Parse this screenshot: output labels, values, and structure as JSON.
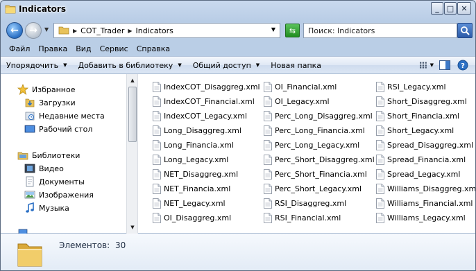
{
  "window": {
    "title": "Indicators"
  },
  "address": {
    "crumbs": [
      "COT_Trader",
      "Indicators"
    ]
  },
  "search": {
    "placeholder": "Поиск: Indicators"
  },
  "menu": [
    "Файл",
    "Правка",
    "Вид",
    "Сервис",
    "Справка"
  ],
  "toolbar": {
    "organize": "Упорядочить",
    "add_to_library": "Добавить в библиотеку",
    "share": "Общий доступ",
    "new_folder": "Новая папка"
  },
  "navpane": {
    "favorites": {
      "label": "Избранное",
      "items": [
        "Загрузки",
        "Недавние места",
        "Рабочий стол"
      ]
    },
    "libraries": {
      "label": "Библиотеки",
      "items": [
        "Видео",
        "Документы",
        "Изображения",
        "Музыка"
      ]
    }
  },
  "files": [
    [
      "IndexCOT_Disaggreg.xml",
      "IndexCOT_Financial.xml",
      "IndexCOT_Legacy.xml",
      "Long_Disaggreg.xml",
      "Long_Financia.xml",
      "Long_Legacy.xml",
      "NET_Disaggreg.xml",
      "NET_Financia.xml",
      "NET_Legacy.xml",
      "OI_Disaggreg.xml"
    ],
    [
      "OI_Financial.xml",
      "OI_Legacy.xml",
      "Perc_Long_Disaggreg.xml",
      "Perc_Long_Financia.xml",
      "Perc_Long_Legacy.xml",
      "Perc_Short_Disaggreg.xml",
      "Perc_Short_Financia.xml",
      "Perc_Short_Legacy.xml",
      "RSI_Disaggreg.xml",
      "RSI_Financial.xml"
    ],
    [
      "RSI_Legacy.xml",
      "Short_Disaggreg.xml",
      "Short_Financia.xml",
      "Short_Legacy.xml",
      "Spread_Disaggreg.xml",
      "Spread_Financia.xml",
      "Spread_Legacy.xml",
      "Williams_Disaggreg.xml",
      "Williams_Financial.xml",
      "Williams_Legacy.xml"
    ]
  ],
  "status": {
    "label": "Элементов:",
    "count": "30"
  },
  "colors": {
    "folder": "#e8c25a",
    "accent": "#2a6fc4",
    "refresh": "#1f8d1f"
  }
}
